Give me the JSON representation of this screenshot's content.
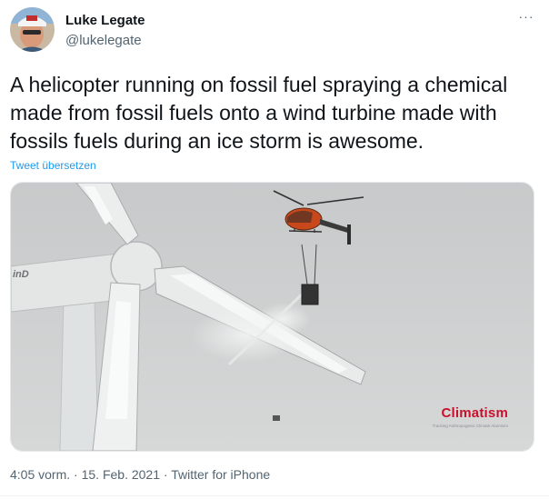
{
  "user": {
    "name": "Luke Legate",
    "handle": "@lukelegate"
  },
  "tweet": {
    "text": "A helicopter running on fossil fuel spraying a chemical made from fossil fuels onto a wind turbine made with fossils fuels during an ice storm is awesome.",
    "translate_link": "Tweet übersetzen",
    "more_icon": "more-horizontal-icon",
    "more_label": "···"
  },
  "media": {
    "brand": "Climatism",
    "brand_tagline": "Tracking Anthropogenic Climate Alarmism",
    "nacelle_mark": "inD",
    "colors": {
      "sky": "#cfd1d2",
      "ice": "#e9ecec",
      "helicopter": "#c8471b",
      "brand": "#c8102e"
    }
  },
  "meta": {
    "time": "4:05 vorm.",
    "date": "15. Feb. 2021",
    "source": "Twitter for iPhone",
    "separator": "·"
  }
}
